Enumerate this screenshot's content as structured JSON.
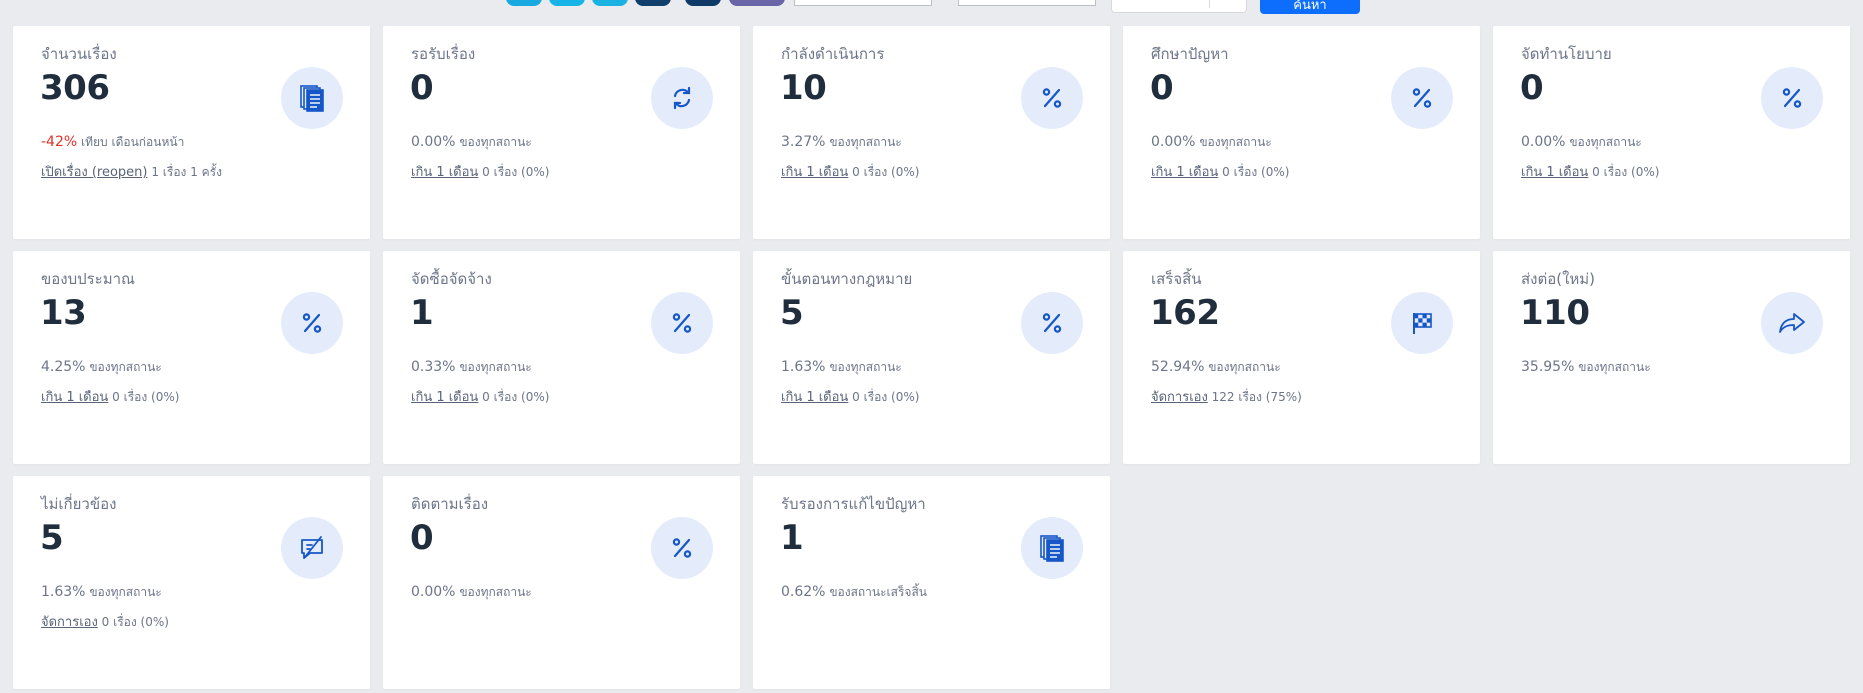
{
  "toolbar": {
    "search_label": "ค้นหา",
    "button_colors": [
      "#17a9e0",
      "#17b4e8",
      "#1ab2e2",
      "#113f6b",
      "#0f3a66",
      "#6a64a8"
    ]
  },
  "cards": [
    {
      "title": "จำนวนเรื่อง",
      "value": "306",
      "pct": "-42%",
      "pct_text": "เทียบ เดือนก่อนหน้า",
      "link": "เปิดเรื่อง (reopen)",
      "link_text": "1 เรื่อง 1 ครั้ง",
      "icon": "documents-icon",
      "negative": true
    },
    {
      "title": "รอรับเรื่อง",
      "value": "0",
      "pct": "0.00%",
      "pct_text": "ของทุกสถานะ",
      "link": "เกิน 1 เดือน",
      "link_text": "0 เรื่อง (0%)",
      "icon": "refresh-icon"
    },
    {
      "title": "กำลังดำเนินการ",
      "value": "10",
      "pct": "3.27%",
      "pct_text": "ของทุกสถานะ",
      "link": "เกิน 1 เดือน",
      "link_text": "0 เรื่อง (0%)",
      "icon": "percent-icon"
    },
    {
      "title": "ศึกษาปัญหา",
      "value": "0",
      "pct": "0.00%",
      "pct_text": "ของทุกสถานะ",
      "link": "เกิน 1 เดือน",
      "link_text": "0 เรื่อง (0%)",
      "icon": "percent-icon"
    },
    {
      "title": "จัดทำนโยบาย",
      "value": "0",
      "pct": "0.00%",
      "pct_text": "ของทุกสถานะ",
      "link": "เกิน 1 เดือน",
      "link_text": "0 เรื่อง (0%)",
      "icon": "percent-icon"
    },
    {
      "title": "ของบประมาณ",
      "value": "13",
      "pct": "4.25%",
      "pct_text": "ของทุกสถานะ",
      "link": "เกิน 1 เดือน",
      "link_text": "0 เรื่อง (0%)",
      "icon": "percent-icon"
    },
    {
      "title": "จัดซื้อจัดจ้าง",
      "value": "1",
      "pct": "0.33%",
      "pct_text": "ของทุกสถานะ",
      "link": "เกิน 1 เดือน",
      "link_text": "0 เรื่อง (0%)",
      "icon": "percent-icon"
    },
    {
      "title": "ขั้นตอนทางกฎหมาย",
      "value": "5",
      "pct": "1.63%",
      "pct_text": "ของทุกสถานะ",
      "link": "เกิน 1 เดือน",
      "link_text": "0 เรื่อง (0%)",
      "icon": "percent-icon"
    },
    {
      "title": "เสร็จสิ้น",
      "value": "162",
      "pct": "52.94%",
      "pct_text": "ของทุกสถานะ",
      "link": "จัดการเอง",
      "link_text": "122 เรื่อง (75%)",
      "icon": "checkered-flag-icon"
    },
    {
      "title": "ส่งต่อ(ใหม่)",
      "value": "110",
      "pct": "35.95%",
      "pct_text": "ของทุกสถานะ",
      "link": "",
      "link_text": "",
      "icon": "share-arrow-icon"
    },
    {
      "title": "ไม่เกี่ยวข้อง",
      "value": "5",
      "pct": "1.63%",
      "pct_text": "ของทุกสถานะ",
      "link": "จัดการเอง",
      "link_text": "0 เรื่อง (0%)",
      "icon": "chat-slash-icon"
    },
    {
      "title": "ติดตามเรื่อง",
      "value": "0",
      "pct": "0.00%",
      "pct_text": "ของทุกสถานะ",
      "link": "",
      "link_text": "",
      "icon": "percent-icon"
    },
    {
      "title": "รับรองการแก้ไขปัญหา",
      "value": "1",
      "pct": "0.62%",
      "pct_text": "ของสถานะเสร็จสิ้น",
      "link": "",
      "link_text": "",
      "icon": "documents-icon"
    }
  ]
}
